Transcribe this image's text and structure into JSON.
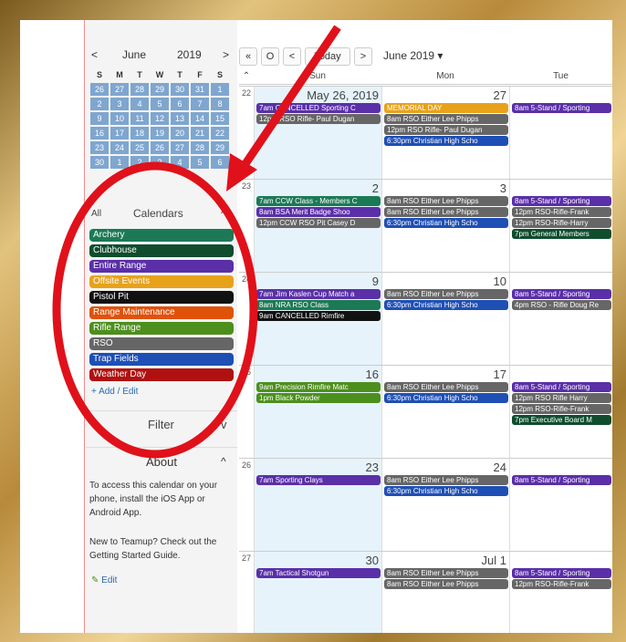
{
  "mini": {
    "month": "June",
    "year": "2019",
    "prev": "<",
    "next": ">",
    "dow": [
      "S",
      "M",
      "T",
      "W",
      "T",
      "F",
      "S"
    ],
    "weeks": [
      [
        "26",
        "27",
        "28",
        "29",
        "30",
        "31",
        "1"
      ],
      [
        "2",
        "3",
        "4",
        "5",
        "6",
        "7",
        "8"
      ],
      [
        "9",
        "10",
        "11",
        "12",
        "13",
        "14",
        "15"
      ],
      [
        "16",
        "17",
        "18",
        "19",
        "20",
        "21",
        "22"
      ],
      [
        "23",
        "24",
        "25",
        "26",
        "27",
        "28",
        "29"
      ],
      [
        "30",
        "1",
        "2",
        "3",
        "4",
        "5",
        "6"
      ]
    ]
  },
  "calendars": {
    "all": "All",
    "title": "Calendars",
    "toggle": "^",
    "items": [
      {
        "label": "Archery",
        "color": "#1b7a55"
      },
      {
        "label": "Clubhouse",
        "color": "#0f4d2e"
      },
      {
        "label": "Entire Range",
        "color": "#5a2fa8"
      },
      {
        "label": "Offsite Events",
        "color": "#e8a21a"
      },
      {
        "label": "Pistol Pit",
        "color": "#111111"
      },
      {
        "label": "Range Maintenance",
        "color": "#e0520a"
      },
      {
        "label": "Rifle Range",
        "color": "#4d8f1d"
      },
      {
        "label": "RSO",
        "color": "#666666"
      },
      {
        "label": "Trap Fields",
        "color": "#1e4fb5"
      },
      {
        "label": "Weather Day",
        "color": "#b01010"
      }
    ],
    "add": "+ Add / Edit"
  },
  "filter": {
    "label": "Filter",
    "toggle": "v"
  },
  "about": {
    "label": "About",
    "toggle": "^",
    "text1": "To access this calendar on your phone, install the iOS App or Android App.",
    "text2": "New to Teamup? Check out the Getting Started Guide.",
    "edit": "Edit"
  },
  "toolbar": {
    "first": "«",
    "refresh": "O",
    "prev": "<",
    "today": "Today",
    "next": ">",
    "range": "June 2019 ▾"
  },
  "columns": [
    "Sun",
    "Mon",
    "Tue"
  ],
  "weeks": [
    {
      "num": "22",
      "days": [
        {
          "n": "May 26, 2019",
          "ev": [
            {
              "t": "7am CANCELLED Sporting C",
              "c": "#5a2fa8"
            },
            {
              "t": "12pm RSO Rifle- Paul Dugan",
              "c": "#666666"
            }
          ]
        },
        {
          "n": "27",
          "ev": [
            {
              "t": "MEMORIAL DAY",
              "c": "#e8a21a"
            },
            {
              "t": "8am RSO Either Lee Phipps",
              "c": "#666666"
            },
            {
              "t": "12pm RSO Rifle- Paul Dugan",
              "c": "#666666"
            },
            {
              "t": "6:30pm Christian High Scho",
              "c": "#1e4fb5"
            }
          ]
        },
        {
          "n": "",
          "ev": [
            {
              "t": "8am 5-Stand / Sporting",
              "c": "#5a2fa8"
            }
          ]
        }
      ]
    },
    {
      "num": "23",
      "days": [
        {
          "n": "2",
          "ev": [
            {
              "t": "7am CCW Class - Members C",
              "c": "#1b7a55"
            },
            {
              "t": "8am BSA Merit Badge Shoo",
              "c": "#5a2fa8"
            },
            {
              "t": "12pm CCW RSO Pit Casey D",
              "c": "#666666"
            }
          ]
        },
        {
          "n": "3",
          "ev": [
            {
              "t": "8am RSO Either Lee Phipps",
              "c": "#666666"
            },
            {
              "t": "8am RSO Either Lee Phipps",
              "c": "#666666"
            },
            {
              "t": "6:30pm Christian High Scho",
              "c": "#1e4fb5"
            }
          ]
        },
        {
          "n": "",
          "ev": [
            {
              "t": "8am 5-Stand / Sporting",
              "c": "#5a2fa8"
            },
            {
              "t": "12pm RSO-Rifle-Frank",
              "c": "#666666"
            },
            {
              "t": "12pm RSO-Rifle-Harry",
              "c": "#666666"
            },
            {
              "t": "7pm General Members",
              "c": "#0f4d2e"
            }
          ]
        }
      ]
    },
    {
      "num": "24",
      "days": [
        {
          "n": "9",
          "ev": [
            {
              "t": "7am Jim Kaslen Cup Match a",
              "c": "#5a2fa8"
            },
            {
              "t": "8am NRA RSO Class",
              "c": "#1b7a55"
            },
            {
              "t": "9am CANCELLED Rimfire",
              "c": "#111111"
            }
          ]
        },
        {
          "n": "10",
          "ev": [
            {
              "t": "8am RSO Either Lee Phipps",
              "c": "#666666"
            },
            {
              "t": "6:30pm Christian High Scho",
              "c": "#1e4fb5"
            }
          ]
        },
        {
          "n": "",
          "ev": [
            {
              "t": "8am 5-Stand / Sporting",
              "c": "#5a2fa8"
            },
            {
              "t": "4pm RSO - Rifle Doug Re",
              "c": "#666666"
            }
          ]
        }
      ]
    },
    {
      "num": "25",
      "days": [
        {
          "n": "16",
          "ev": [
            {
              "t": "9am Precision Rimfire Matc",
              "c": "#4d8f1d"
            },
            {
              "t": "1pm Black Powder",
              "c": "#4d8f1d"
            }
          ]
        },
        {
          "n": "17",
          "ev": [
            {
              "t": "8am RSO Either Lee Phipps",
              "c": "#666666"
            },
            {
              "t": "6:30pm Christian High Scho",
              "c": "#1e4fb5"
            }
          ]
        },
        {
          "n": "",
          "ev": [
            {
              "t": "8am 5-Stand / Sporting",
              "c": "#5a2fa8"
            },
            {
              "t": "12pm RSO Rifle Harry",
              "c": "#666666"
            },
            {
              "t": "12pm RSO-Rifle-Frank",
              "c": "#666666"
            },
            {
              "t": "7pm Executive Board M",
              "c": "#0f4d2e"
            }
          ]
        }
      ]
    },
    {
      "num": "26",
      "days": [
        {
          "n": "23",
          "ev": [
            {
              "t": "7am Sporting Clays",
              "c": "#5a2fa8"
            }
          ]
        },
        {
          "n": "24",
          "ev": [
            {
              "t": "8am RSO Either Lee Phipps",
              "c": "#666666"
            },
            {
              "t": "6:30pm Christian High Scho",
              "c": "#1e4fb5"
            }
          ]
        },
        {
          "n": "",
          "ev": [
            {
              "t": "8am 5-Stand / Sporting",
              "c": "#5a2fa8"
            }
          ]
        }
      ]
    },
    {
      "num": "27",
      "days": [
        {
          "n": "30",
          "ev": [
            {
              "t": "7am Tactical Shotgun",
              "c": "#5a2fa8"
            }
          ]
        },
        {
          "n": "Jul 1",
          "ev": [
            {
              "t": "8am RSO Either Lee Phipps",
              "c": "#666666"
            },
            {
              "t": "8am RSO Either Lee Phipps",
              "c": "#666666"
            }
          ]
        },
        {
          "n": "",
          "ev": [
            {
              "t": "8am 5-Stand / Sporting",
              "c": "#5a2fa8"
            },
            {
              "t": "12pm RSO-Rifle-Frank",
              "c": "#666666"
            }
          ]
        }
      ]
    }
  ]
}
